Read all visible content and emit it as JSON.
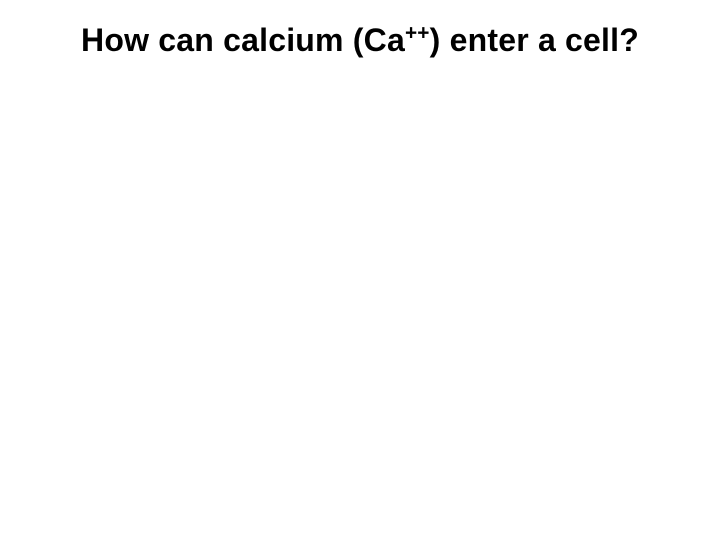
{
  "slide": {
    "title_pre": "How can calcium (Ca",
    "title_sup": "++",
    "title_post": ") enter a cell?"
  }
}
